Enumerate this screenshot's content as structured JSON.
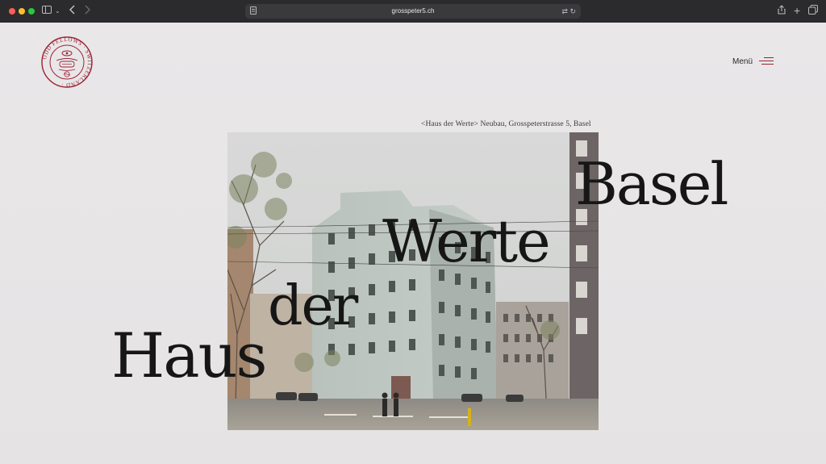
{
  "browser": {
    "url": "grosspeter5.ch"
  },
  "header": {
    "logo_name": "ODD FELLOWS SWITZERLAND",
    "menu_label": "Menü"
  },
  "hero": {
    "caption": "<Haus der Werte> Neubau, Grosspeterstrasse 5, Basel",
    "title_words": [
      "Haus",
      "der",
      "Werte",
      "Basel"
    ]
  },
  "colors": {
    "accent": "#9b2434",
    "text": "#161616",
    "background": "#e8e6e7"
  }
}
